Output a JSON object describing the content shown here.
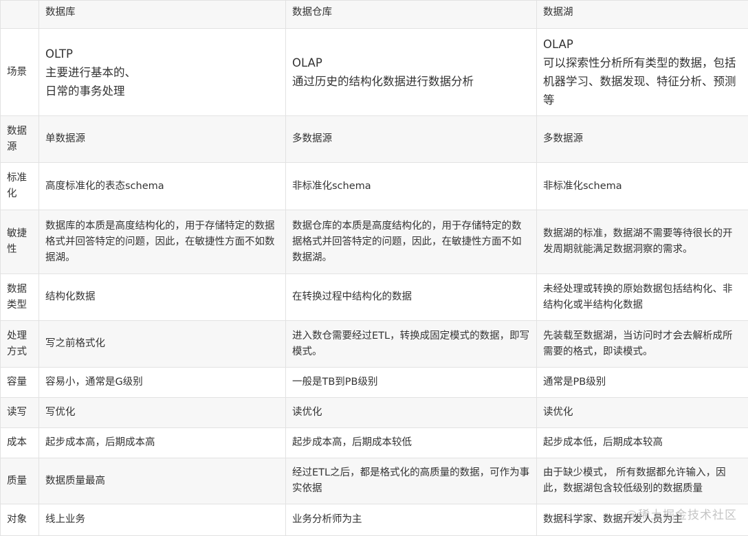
{
  "table": {
    "headers": [
      "",
      "数据库",
      "数据仓库",
      "数据湖"
    ],
    "rows": [
      {
        "label": "场景",
        "cells": [
          "OLTP\n主要进行基本的、\n日常的事务处理",
          "OLAP\n通过历史的结构化数据进行数据分析",
          "OLAP\n可以探索性分析所有类型的数据，包括机器学习、数据发现、特征分析、预测等"
        ]
      },
      {
        "label": "数据源",
        "cells": [
          "单数据源",
          "多数据源",
          "多数据源"
        ]
      },
      {
        "label": "标准化",
        "cells": [
          "高度标准化的表态schema",
          "非标准化schema",
          "非标准化schema"
        ]
      },
      {
        "label": "敏捷性",
        "cells": [
          "数据库的本质是高度结构化的，用于存储特定的数据格式并回答特定的问题，因此，在敏捷性方面不如数据湖。",
          "数据仓库的本质是高度结构化的，用于存储特定的数据格式并回答特定的问题，因此，在敏捷性方面不如数据湖。",
          "数据湖的标准，数据湖不需要等待很长的开发周期就能满足数据洞察的需求。"
        ]
      },
      {
        "label": "数据类型",
        "cells": [
          "结构化数据",
          "在转换过程中结构化的数据",
          "未经处理或转换的原始数据包括结构化、非结构化或半结构化数据"
        ]
      },
      {
        "label": "处理方式",
        "cells": [
          "写之前格式化",
          "进入数仓需要经过ETL，转换成固定模式的数据，即写模式。",
          "先装载至数据湖，当访问时才会去解析成所需要的格式，即读模式。"
        ]
      },
      {
        "label": "容量",
        "cells": [
          "容易小，通常是G级别",
          "一般是TB到PB级别",
          "通常是PB级别"
        ]
      },
      {
        "label": "读写",
        "cells": [
          "写优化",
          "读优化",
          "读优化"
        ]
      },
      {
        "label": "成本",
        "cells": [
          "起步成本高，后期成本高",
          "起步成本高，后期成本较低",
          "起步成本低，后期成本较高"
        ]
      },
      {
        "label": "质量",
        "cells": [
          "数据质量最高",
          "经过ETL之后，都是格式化的高质量的数据，可作为事实依据",
          "由于缺少模式， 所有数据都允许输入，因此，数据湖包含较低级别的数据质量"
        ]
      },
      {
        "label": "对象",
        "cells": [
          "线上业务",
          "业务分析师为主",
          "数据科学家、数据开发人员为主"
        ]
      }
    ]
  },
  "watermark": "@稀土掘金技术社区"
}
